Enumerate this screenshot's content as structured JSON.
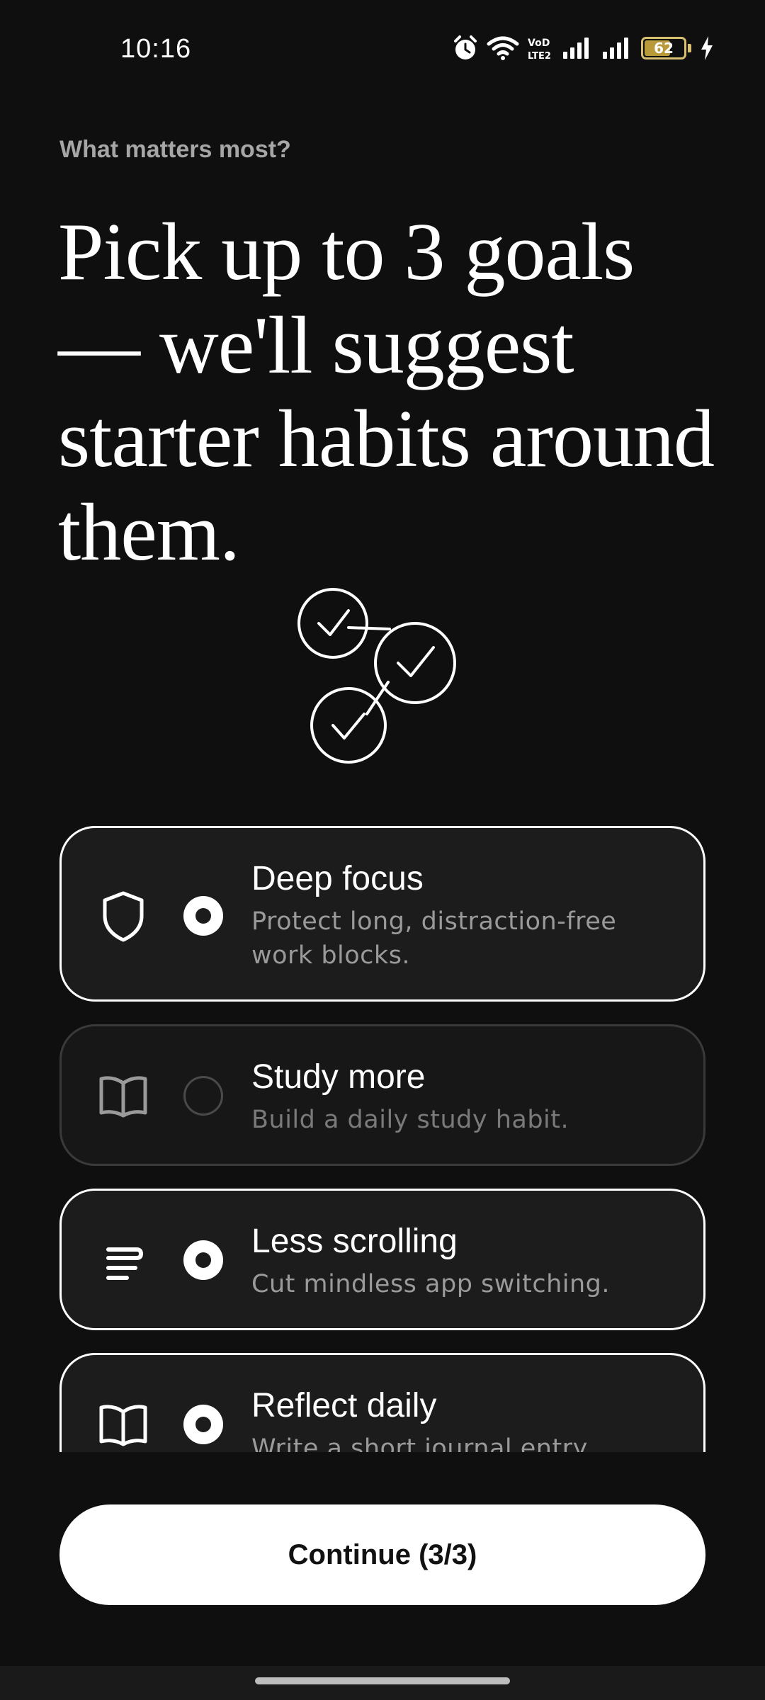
{
  "status_bar": {
    "time": "10:16",
    "battery_level": "62",
    "icons": [
      "alarm-icon",
      "wifi-icon",
      "volte-icon",
      "signal-icon",
      "signal-icon",
      "battery-icon",
      "charging-icon"
    ]
  },
  "header": {
    "eyebrow": "What matters most?",
    "title": "Pick up to 3 goals — we'll suggest starter habits around them."
  },
  "illustration": {
    "icon": "checkmarks-illustration"
  },
  "goals": [
    {
      "title": "Deep focus",
      "description": "Protect long, distraction-free work blocks.",
      "icon": "shield-icon",
      "selected": true
    },
    {
      "title": "Study more",
      "description": "Build a daily study habit.",
      "icon": "book-icon",
      "selected": false
    },
    {
      "title": "Less scrolling",
      "description": "Cut mindless app switching.",
      "icon": "lines-icon",
      "selected": true
    },
    {
      "title": "Reflect daily",
      "description": "Write a short journal entry.",
      "icon": "book-icon",
      "selected": true
    }
  ],
  "continue_button": {
    "label": "Continue (3/3)"
  },
  "colors": {
    "background": "#0f0f0f",
    "card": "#1c1c1c",
    "accent": "#ffffff",
    "muted_text": "#9a9a9a"
  }
}
